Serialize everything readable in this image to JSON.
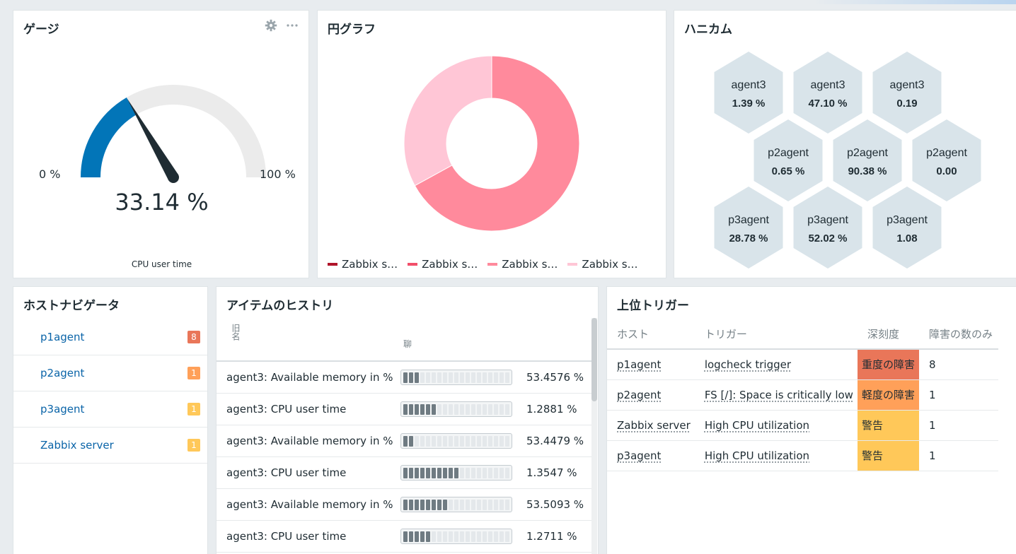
{
  "colors": {
    "gauge_fill": "#0275b8",
    "gauge_track": "#ebebeb",
    "needle": "#1f2c33",
    "pie": [
      "#b0142a",
      "#f24f6a",
      "#ff8a9c",
      "#ffc6d6"
    ],
    "hex_bg": "#d9e4ea",
    "badge_high": "#e97659",
    "badge_avg": "#ffa059",
    "badge_warn": "#ffc859",
    "link": "#0a64a8"
  },
  "gauge": {
    "title": "ゲージ",
    "min_label": "0 %",
    "max_label": "100 %",
    "value_label": "33.14 %",
    "value_percent": 33.14,
    "description": "CPU user time",
    "tool_settings": "gear-icon",
    "tool_more": "more-icon"
  },
  "pie": {
    "title": "円グラフ",
    "slices": [
      0.0,
      0.0,
      67.0,
      33.0
    ],
    "legend": [
      "Zabbix s…",
      "Zabbix s…",
      "Zabbix s…",
      "Zabbix s…"
    ]
  },
  "honeycomb": {
    "title": "ハニカム",
    "cells": [
      {
        "host": "agent3",
        "value": "1.39 %"
      },
      {
        "host": "agent3",
        "value": "47.10 %"
      },
      {
        "host": "agent3",
        "value": "0.19"
      },
      {
        "host": "p2agent",
        "value": "0.65 %"
      },
      {
        "host": "p2agent",
        "value": "90.38 %"
      },
      {
        "host": "p2agent",
        "value": "0.00"
      },
      {
        "host": "p3agent",
        "value": "28.78 %"
      },
      {
        "host": "p3agent",
        "value": "52.02 %"
      },
      {
        "host": "p3agent",
        "value": "1.08"
      }
    ]
  },
  "navigator": {
    "title": "ホストナビゲータ",
    "hosts": [
      {
        "name": "p1agent",
        "count": "8",
        "color": "#e97659"
      },
      {
        "name": "p2agent",
        "count": "1",
        "color": "#ffa059"
      },
      {
        "name": "p3agent",
        "count": "1",
        "color": "#ffc859"
      },
      {
        "name": "Zabbix server",
        "count": "1",
        "color": "#ffc859"
      }
    ]
  },
  "history": {
    "title": "アイテムのヒストリ",
    "header_icon_1": "旧名",
    "header_icon_2": "聊",
    "rows": [
      {
        "label": "agent3: Available memory in %",
        "value": "53.4576 %",
        "filled": 3
      },
      {
        "label": "agent3: CPU user time",
        "value": "1.2881 %",
        "filled": 6
      },
      {
        "label": "agent3: Available memory in %",
        "value": "53.4479 %",
        "filled": 2
      },
      {
        "label": "agent3: CPU user time",
        "value": "1.3547 %",
        "filled": 10
      },
      {
        "label": "agent3: Available memory in %",
        "value": "53.5093 %",
        "filled": 8
      },
      {
        "label": "agent3: CPU user time",
        "value": "1.2711 %",
        "filled": 5
      }
    ]
  },
  "triggers": {
    "title": "上位トリガー",
    "columns": [
      "ホスト",
      "トリガー",
      "深刻度",
      "障害の数のみ"
    ],
    "rows": [
      {
        "host": "p1agent",
        "trigger": "logcheck trigger",
        "severity": "重度の障害",
        "color": "#e97659",
        "count": "8"
      },
      {
        "host": "p2agent",
        "trigger": "FS [/]: Space is critically low",
        "severity": "軽度の障害",
        "color": "#ffa059",
        "count": "1"
      },
      {
        "host": "Zabbix server",
        "trigger": "High CPU utilization",
        "severity": "警告",
        "color": "#ffc859",
        "count": "1"
      },
      {
        "host": "p3agent",
        "trigger": "High CPU utilization",
        "severity": "警告",
        "color": "#ffc859",
        "count": "1"
      }
    ]
  }
}
